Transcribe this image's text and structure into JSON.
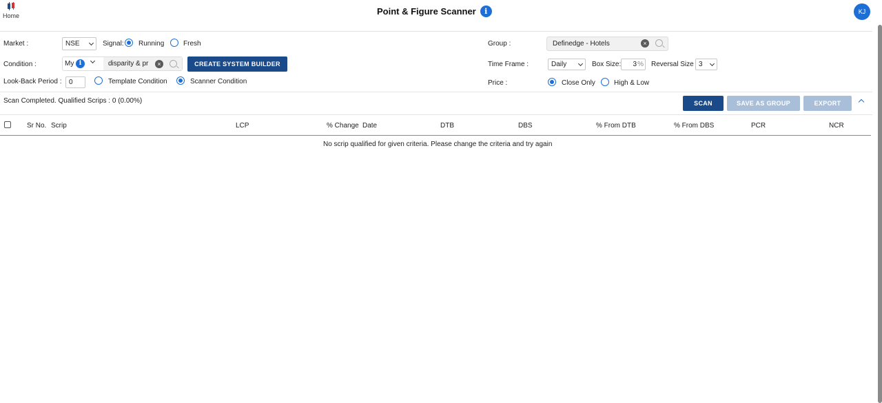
{
  "header": {
    "home_label": "Home",
    "title": "Point & Figure Scanner",
    "info_glyph": "i",
    "avatar_initials": "KJ"
  },
  "filters": {
    "market_label": "Market :",
    "market_value": "NSE",
    "signal_label": "Signal:",
    "signal_options": [
      "Running",
      "Fresh"
    ],
    "signal_selected": "Running",
    "condition_label": "Condition :",
    "condition_prefix": "My",
    "condition_value": "disparity & pr",
    "create_button": "CREATE SYSTEM BUILDER",
    "lookback_label": "Look-Back Period :",
    "lookback_value": "0",
    "condition_type_options": [
      "Template Condition",
      "Scanner Condition"
    ],
    "condition_type_selected": "Scanner Condition",
    "group_label": "Group :",
    "group_value": "Definedge - Hotels",
    "timeframe_label": "Time Frame :",
    "timeframe_value": "Daily",
    "boxsize_label": "Box Size:",
    "boxsize_value": "3",
    "boxsize_unit": "%",
    "reversal_label": "Reversal Size :",
    "reversal_value": "3",
    "price_label": "Price :",
    "price_options": [
      "Close Only",
      "High & Low"
    ],
    "price_selected": "Close Only"
  },
  "actions": {
    "status": "Scan Completed. Qualified Scrips : 0 (0.00%)",
    "scan": "SCAN",
    "save_as_group": "SAVE AS GROUP",
    "export": "EXPORT"
  },
  "table": {
    "columns": [
      "Sr No.",
      "Scrip",
      "LCP",
      "% Change",
      "Date",
      "DTB",
      "DBS",
      "% From DTB",
      "% From DBS",
      "PCR",
      "NCR"
    ],
    "empty_message": "No scrip qualified for given criteria. Please change the criteria and try again"
  },
  "colors": {
    "primary": "#1a4a8a",
    "accent": "#1d6fd6",
    "disabled": "#a9bfd9"
  }
}
